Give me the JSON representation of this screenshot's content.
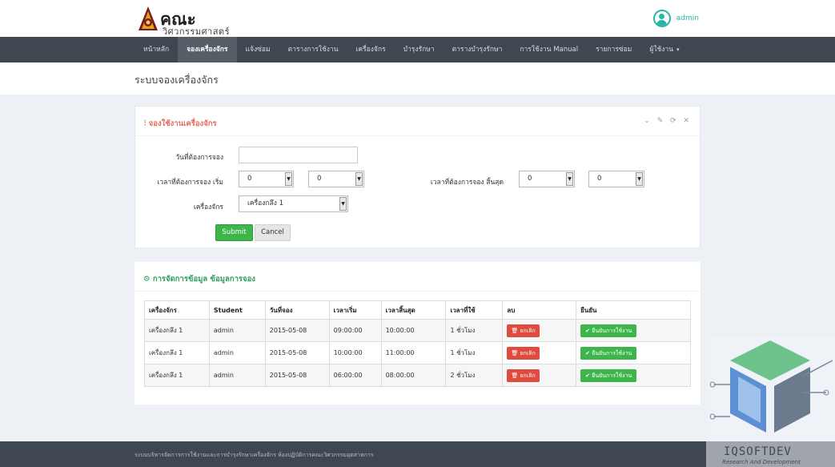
{
  "header": {
    "logo_main": "คณะ",
    "logo_sub": "วิศวกรรมศาสตร์",
    "username": "admin"
  },
  "nav": [
    {
      "label": "หน้าหลัก"
    },
    {
      "label": "จองเครื่องจักร"
    },
    {
      "label": "แจ้งซ่อม"
    },
    {
      "label": "ตารางการใช้งาน"
    },
    {
      "label": "เครื่องจักร"
    },
    {
      "label": "บำรุงรักษา"
    },
    {
      "label": "ตารางบำรุงรักษา"
    },
    {
      "label": "การใช้งาน Manual"
    },
    {
      "label": "รายการซ่อม"
    },
    {
      "label": "ผู้ใช้งาน"
    }
  ],
  "page_title": "ระบบจองเครื่องจักร",
  "form_panel": {
    "title": "จองใช้งานเครื่องจักร",
    "tools": "⌄ ✎ ⟳ ✕",
    "date_label": "วันที่ต้องการจอง",
    "date_value": "",
    "start_label": "เวลาที่ต้องการจอง เริ่ม",
    "start_hour": "0",
    "start_minute": "0",
    "end_label": "เวลาที่ต้องการจอง สิ้นสุด",
    "end_hour": "0",
    "end_minute": "0",
    "machine_label": "เครื่องจักร",
    "machine_value": "เครื่องกลึง 1",
    "submit_label": "Submit",
    "cancel_label": "Cancel"
  },
  "table_panel": {
    "title": "การจัดการข้อมูล ข้อมูลการจอง",
    "columns": [
      "เครื่องจักร",
      "Student",
      "วันที่จอง",
      "เวลาเริ่ม",
      "เวลาสิ้นสุด",
      "เวลาที่ใช้",
      "ลบ",
      "ยืนยัน"
    ],
    "rows": [
      {
        "machine": "เครื่องกลึง 1",
        "student": "admin",
        "date": "2015-05-08",
        "start": "09:00:00",
        "end": "10:00:00",
        "duration": "1 ชั่วโมง"
      },
      {
        "machine": "เครื่องกลึง 1",
        "student": "admin",
        "date": "2015-05-08",
        "start": "10:00:00",
        "end": "11:00:00",
        "duration": "1 ชั่วโมง"
      },
      {
        "machine": "เครื่องกลึง 1",
        "student": "admin",
        "date": "2015-05-08",
        "start": "06:00:00",
        "end": "08:00:00",
        "duration": "2 ชั่วโมง"
      }
    ],
    "delete_label": "ยกเลิก",
    "confirm_label": "ยืนยันการใช้งาน"
  },
  "footer_text": "ระบบบริหารจัดการการใช้งานและการบำรุงรักษาเครื่องจักร ห้องปฏิบัติการคณะวิศวกรรมอุตสาหการ",
  "watermark": {
    "name": "IQSOFTDEV",
    "tagline": "Research And Development"
  },
  "colors": {
    "navbar": "#3f4751",
    "accent_teal": "#26b5a6",
    "success": "#3cb54a",
    "danger": "#e04b3f",
    "panel_title_red": "#e86c5d"
  }
}
